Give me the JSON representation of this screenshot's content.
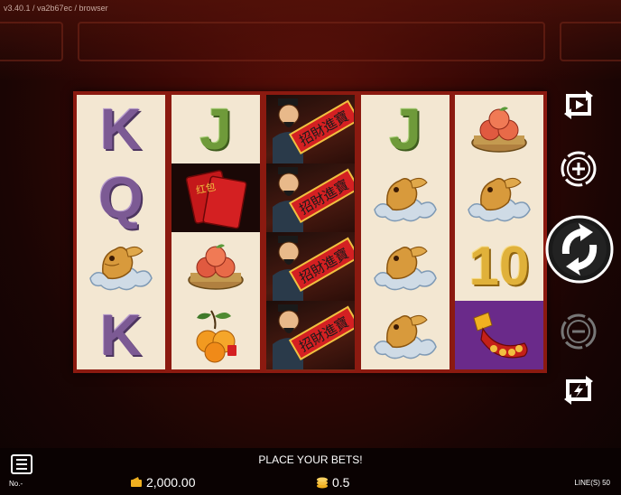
{
  "version": "v3.40.1 / va2b67ec / browser",
  "status_message": "PLACE YOUR BETS!",
  "balance": "2,000.00",
  "bet": "0.5",
  "lines_label": "LINE(S) 50",
  "number_label": "No.-",
  "reels": [
    [
      "K",
      "Q",
      "goldfish",
      "K"
    ],
    [
      "J",
      "red-envelope",
      "peach-basket",
      "orange-branch"
    ],
    [
      "god-of-wealth",
      "god-of-wealth",
      "god-of-wealth",
      "god-of-wealth"
    ],
    [
      "J",
      "goldfish",
      "goldfish",
      "goldfish"
    ],
    [
      "peach-basket",
      "goldfish",
      "10",
      "gold-ingot"
    ]
  ],
  "envelope_text": "红包",
  "scroll_chars": "招財進寶",
  "controls": [
    "autoplay-icon",
    "bet-increase-icon",
    "spin-icon",
    "bet-decrease-icon",
    "turbo-icon"
  ],
  "colors": {
    "reel_frame": "#8b1a10",
    "reel_bg": "#f3e7d2",
    "letters_purple": "#7c5a94",
    "letters_green": "#6f9a3a",
    "ten_gold": "#e0b13a"
  }
}
